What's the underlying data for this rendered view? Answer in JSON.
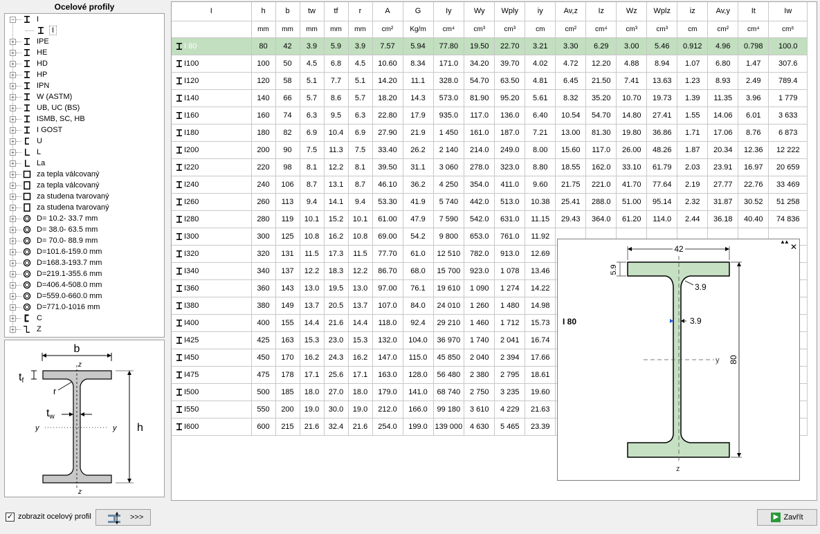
{
  "tree": {
    "title": "Ocelové profily",
    "items": [
      {
        "label": "I",
        "icon": "i-beam-icon",
        "expanded": true
      },
      {
        "label": "I",
        "icon": "i-beam-icon",
        "child": true
      },
      {
        "label": "IPE",
        "icon": "i-beam-icon"
      },
      {
        "label": "HE",
        "icon": "i-beam-icon"
      },
      {
        "label": "HD",
        "icon": "i-beam-icon"
      },
      {
        "label": "HP",
        "icon": "i-beam-icon"
      },
      {
        "label": "IPN",
        "icon": "i-beam-icon"
      },
      {
        "label": "W (ASTM)",
        "icon": "i-beam-icon"
      },
      {
        "label": "UB, UC (BS)",
        "icon": "i-beam-icon"
      },
      {
        "label": "ISMB, SC, HB",
        "icon": "i-beam-icon"
      },
      {
        "label": "I GOST",
        "icon": "i-beam-icon"
      },
      {
        "label": "U",
        "icon": "channel-icon"
      },
      {
        "label": "L",
        "icon": "angle-icon"
      },
      {
        "label": "La",
        "icon": "angle-icon"
      },
      {
        "label": "za tepla válcovaný",
        "icon": "square-tube-icon"
      },
      {
        "label": "za tepla válcovaný",
        "icon": "rect-tube-icon"
      },
      {
        "label": "za studena tvarovaný",
        "icon": "square-tube-icon"
      },
      {
        "label": "za studena tvarovaný",
        "icon": "rect-tube-icon"
      },
      {
        "label": "D= 10.2- 33.7 mm",
        "icon": "round-tube-icon"
      },
      {
        "label": "D= 38.0- 63.5 mm",
        "icon": "round-tube-icon"
      },
      {
        "label": "D= 70.0- 88.9 mm",
        "icon": "round-tube-icon"
      },
      {
        "label": "D=101.6-159.0 mm",
        "icon": "round-tube-icon"
      },
      {
        "label": "D=168.3-193.7 mm",
        "icon": "round-tube-icon"
      },
      {
        "label": "D=219.1-355.6 mm",
        "icon": "round-tube-icon"
      },
      {
        "label": "D=406.4-508.0 mm",
        "icon": "round-tube-icon"
      },
      {
        "label": "D=559.0-660.0 mm",
        "icon": "round-tube-icon"
      },
      {
        "label": "D=771.0-1016 mm",
        "icon": "round-tube-icon"
      },
      {
        "label": "C",
        "icon": "c-profile-icon"
      },
      {
        "label": "Z",
        "icon": "z-profile-icon"
      }
    ]
  },
  "preview": {
    "b": "b",
    "h": "h",
    "tf": "t",
    "tf_sub": "f",
    "tw": "t",
    "tw_sub": "w",
    "r": "r",
    "y": "y",
    "z": "z"
  },
  "grid": {
    "headers": [
      "I",
      "h",
      "b",
      "tw",
      "tf",
      "r",
      "A",
      "G",
      "Iy",
      "Wy",
      "Wply",
      "iy",
      "Av,z",
      "Iz",
      "Wz",
      "Wplz",
      "iz",
      "Av,y",
      "It",
      "Iw"
    ],
    "units": [
      "",
      "mm",
      "mm",
      "mm",
      "mm",
      "mm",
      "cm²",
      "Kg/m",
      "cm⁴",
      "cm³",
      "cm³",
      "cm",
      "cm²",
      "cm⁴",
      "cm³",
      "cm³",
      "cm",
      "cm²",
      "cm⁴",
      "cm⁶"
    ],
    "selected_index": 0,
    "rows": [
      [
        "I 80",
        "80",
        "42",
        "3.9",
        "5.9",
        "3.9",
        "7.57",
        "5.94",
        "77.80",
        "19.50",
        "22.70",
        "3.21",
        "3.30",
        "6.29",
        "3.00",
        "5.46",
        "0.912",
        "4.96",
        "0.798",
        "100.0"
      ],
      [
        "I100",
        "100",
        "50",
        "4.5",
        "6.8",
        "4.5",
        "10.60",
        "8.34",
        "171.0",
        "34.20",
        "39.70",
        "4.02",
        "4.72",
        "12.20",
        "4.88",
        "8.94",
        "1.07",
        "6.80",
        "1.47",
        "307.6"
      ],
      [
        "I120",
        "120",
        "58",
        "5.1",
        "7.7",
        "5.1",
        "14.20",
        "11.1",
        "328.0",
        "54.70",
        "63.50",
        "4.81",
        "6.45",
        "21.50",
        "7.41",
        "13.63",
        "1.23",
        "8.93",
        "2.49",
        "789.4"
      ],
      [
        "I140",
        "140",
        "66",
        "5.7",
        "8.6",
        "5.7",
        "18.20",
        "14.3",
        "573.0",
        "81.90",
        "95.20",
        "5.61",
        "8.32",
        "35.20",
        "10.70",
        "19.73",
        "1.39",
        "11.35",
        "3.96",
        "1 779"
      ],
      [
        "I160",
        "160",
        "74",
        "6.3",
        "9.5",
        "6.3",
        "22.80",
        "17.9",
        "935.0",
        "117.0",
        "136.0",
        "6.40",
        "10.54",
        "54.70",
        "14.80",
        "27.41",
        "1.55",
        "14.06",
        "6.01",
        "3 633"
      ],
      [
        "I180",
        "180",
        "82",
        "6.9",
        "10.4",
        "6.9",
        "27.90",
        "21.9",
        "1 450",
        "161.0",
        "187.0",
        "7.21",
        "13.00",
        "81.30",
        "19.80",
        "36.86",
        "1.71",
        "17.06",
        "8.76",
        "6 873"
      ],
      [
        "I200",
        "200",
        "90",
        "7.5",
        "11.3",
        "7.5",
        "33.40",
        "26.2",
        "2 140",
        "214.0",
        "249.0",
        "8.00",
        "15.60",
        "117.0",
        "26.00",
        "48.26",
        "1.87",
        "20.34",
        "12.36",
        "12 222"
      ],
      [
        "I220",
        "220",
        "98",
        "8.1",
        "12.2",
        "8.1",
        "39.50",
        "31.1",
        "3 060",
        "278.0",
        "323.0",
        "8.80",
        "18.55",
        "162.0",
        "33.10",
        "61.79",
        "2.03",
        "23.91",
        "16.97",
        "20 659"
      ],
      [
        "I240",
        "240",
        "106",
        "8.7",
        "13.1",
        "8.7",
        "46.10",
        "36.2",
        "4 250",
        "354.0",
        "411.0",
        "9.60",
        "21.75",
        "221.0",
        "41.70",
        "77.64",
        "2.19",
        "27.77",
        "22.76",
        "33 469"
      ],
      [
        "I260",
        "260",
        "113",
        "9.4",
        "14.1",
        "9.4",
        "53.30",
        "41.9",
        "5 740",
        "442.0",
        "513.0",
        "10.38",
        "25.41",
        "288.0",
        "51.00",
        "95.14",
        "2.32",
        "31.87",
        "30.52",
        "51 258"
      ],
      [
        "I280",
        "280",
        "119",
        "10.1",
        "15.2",
        "10.1",
        "61.00",
        "47.9",
        "7 590",
        "542.0",
        "631.0",
        "11.15",
        "29.43",
        "364.0",
        "61.20",
        "114.0",
        "2.44",
        "36.18",
        "40.40",
        "74 836"
      ],
      [
        "I300",
        "300",
        "125",
        "10.8",
        "16.2",
        "10.8",
        "69.00",
        "54.2",
        "9 800",
        "653.0",
        "761.0",
        "11.92",
        "",
        "",
        "",
        "",
        "",
        "",
        "",
        ""
      ],
      [
        "I320",
        "320",
        "131",
        "11.5",
        "17.3",
        "11.5",
        "77.70",
        "61.0",
        "12 510",
        "782.0",
        "913.0",
        "12.69",
        "",
        "",
        "",
        "",
        "",
        "",
        "",
        ""
      ],
      [
        "I340",
        "340",
        "137",
        "12.2",
        "18.3",
        "12.2",
        "86.70",
        "68.0",
        "15 700",
        "923.0",
        "1 078",
        "13.46",
        "",
        "",
        "",
        "",
        "",
        "",
        "",
        ""
      ],
      [
        "I360",
        "360",
        "143",
        "13.0",
        "19.5",
        "13.0",
        "97.00",
        "76.1",
        "19 610",
        "1 090",
        "1 274",
        "14.22",
        "",
        "",
        "",
        "",
        "",
        "",
        "",
        ""
      ],
      [
        "I380",
        "380",
        "149",
        "13.7",
        "20.5",
        "13.7",
        "107.0",
        "84.0",
        "24 010",
        "1 260",
        "1 480",
        "14.98",
        "",
        "",
        "",
        "",
        "",
        "",
        "",
        ""
      ],
      [
        "I400",
        "400",
        "155",
        "14.4",
        "21.6",
        "14.4",
        "118.0",
        "92.4",
        "29 210",
        "1 460",
        "1 712",
        "15.73",
        "",
        "",
        "",
        "",
        "",
        "",
        "",
        ""
      ],
      [
        "I425",
        "425",
        "163",
        "15.3",
        "23.0",
        "15.3",
        "132.0",
        "104.0",
        "36 970",
        "1 740",
        "2 041",
        "16.74",
        "",
        "",
        "",
        "",
        "",
        "",
        "",
        ""
      ],
      [
        "I450",
        "450",
        "170",
        "16.2",
        "24.3",
        "16.2",
        "147.0",
        "115.0",
        "45 850",
        "2 040",
        "2 394",
        "17.66",
        "",
        "",
        "",
        "",
        "",
        "",
        "",
        ""
      ],
      [
        "I475",
        "475",
        "178",
        "17.1",
        "25.6",
        "17.1",
        "163.0",
        "128.0",
        "56 480",
        "2 380",
        "2 795",
        "18.61",
        "",
        "",
        "",
        "",
        "",
        "",
        "",
        ""
      ],
      [
        "I500",
        "500",
        "185",
        "18.0",
        "27.0",
        "18.0",
        "179.0",
        "141.0",
        "68 740",
        "2 750",
        "3 235",
        "19.60",
        "",
        "",
        "",
        "",
        "",
        "",
        "",
        ""
      ],
      [
        "I550",
        "550",
        "200",
        "19.0",
        "30.0",
        "19.0",
        "212.0",
        "166.0",
        "99 180",
        "3 610",
        "4 229",
        "21.63",
        "",
        "",
        "",
        "",
        "",
        "",
        "",
        ""
      ],
      [
        "I600",
        "600",
        "215",
        "21.6",
        "32.4",
        "21.6",
        "254.0",
        "199.0",
        "139 000",
        "4 630",
        "5 465",
        "23.39",
        "",
        "",
        "",
        "",
        "",
        "",
        "",
        ""
      ]
    ]
  },
  "popup": {
    "profile_name": "I 80",
    "dim_b": "42",
    "dim_tf": "5.9",
    "dim_r": "3.9",
    "dim_tw": "3.9",
    "dim_h": "80",
    "axis_y": "y",
    "axis_z": "z",
    "collapse_glyph": "▲▲",
    "close_glyph": "✕"
  },
  "bottom": {
    "show_profile_label": "zobrazit ocelový profil",
    "show_profile_checked": true,
    "arrow_button_label": ">>>",
    "close_button_label": "Zavřít"
  }
}
